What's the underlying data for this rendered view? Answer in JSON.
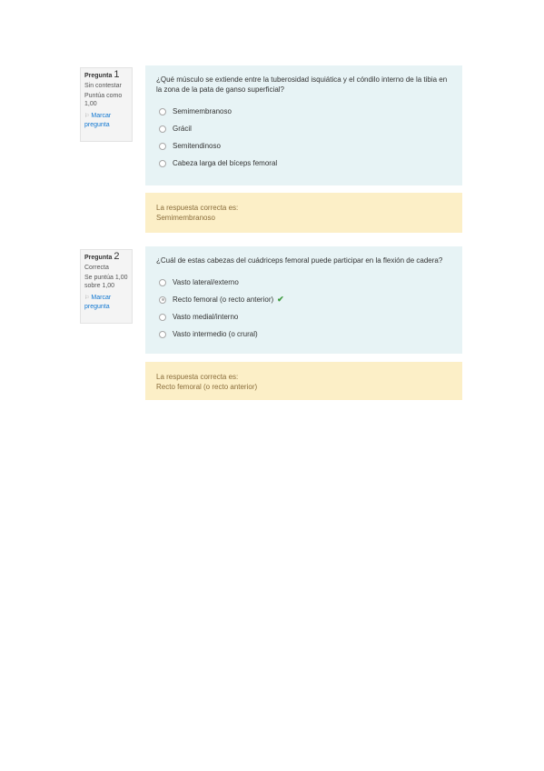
{
  "questions": [
    {
      "label": "Pregunta",
      "number": "1",
      "state": "Sin contestar",
      "grade": "Puntúa como 1,00",
      "flag_label": "Marcar pregunta",
      "text": "¿Qué músculo se extiende entre la tuberosidad isquiática y el cóndilo interno de la tibia en la zona de la pata de ganso superficial?",
      "options": [
        "Semimembranoso",
        "Grácil",
        "Semitendinoso",
        "Cabeza larga del bíceps femoral"
      ],
      "selected_index": -1,
      "feedback_label": "La respuesta correcta es:",
      "correct_answer": "Semimembranoso"
    },
    {
      "label": "Pregunta",
      "number": "2",
      "state": "Correcta",
      "grade": "Se puntúa 1,00 sobre 1,00",
      "flag_label": "Marcar pregunta",
      "text": "¿Cuál de estas cabezas del cuádriceps femoral puede participar en la flexión de cadera?",
      "options": [
        "Vasto lateral/externo",
        "Recto femoral (o recto anterior)",
        "Vasto medial/interno",
        "Vasto intermedio (o crural)"
      ],
      "selected_index": 1,
      "feedback_label": "La respuesta correcta es:",
      "correct_answer": "Recto femoral (o recto anterior)"
    }
  ],
  "icons": {
    "flag": "flag-icon",
    "correct": "check-icon"
  },
  "colors": {
    "question_bg": "#e7f3f5",
    "feedback_bg": "#fcefc7",
    "check": "#3f9b3f",
    "link": "#1177d1"
  }
}
